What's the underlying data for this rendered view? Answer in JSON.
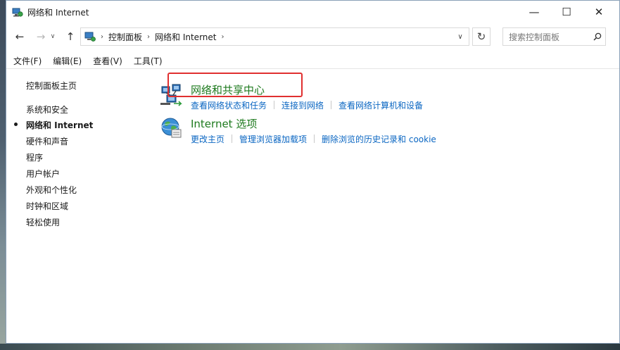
{
  "window": {
    "title": "网络和 Internet",
    "minimize_glyph": "—",
    "maximize_glyph": "☐",
    "close_glyph": "✕"
  },
  "navigation": {
    "back_glyph": "←",
    "forward_glyph": "→",
    "recent_glyph": "∨",
    "up_glyph": "↑",
    "breadcrumbs": [
      "控制面板",
      "网络和 Internet"
    ],
    "crumb_separator": "›",
    "dropdown_glyph": "∨",
    "refresh_glyph": "↻",
    "search_placeholder": "搜索控制面板"
  },
  "menu": {
    "items": [
      "文件(F)",
      "编辑(E)",
      "查看(V)",
      "工具(T)"
    ]
  },
  "sidebar": {
    "home": "控制面板主页",
    "items": [
      "系统和安全",
      "网络和 Internet",
      "硬件和声音",
      "程序",
      "用户帐户",
      "外观和个性化",
      "时钟和区域",
      "轻松使用"
    ],
    "current_index": 1
  },
  "categories": [
    {
      "title": "网络和共享中心",
      "icon": "network-sharing-icon",
      "links": [
        "查看网络状态和任务",
        "连接到网络",
        "查看网络计算机和设备"
      ]
    },
    {
      "title": "Internet 选项",
      "icon": "internet-globe-icon",
      "links": [
        "更改主页",
        "管理浏览器加载项",
        "删除浏览的历史记录和 cookie"
      ]
    }
  ],
  "colors": {
    "category_title": "#1e7a1e",
    "link": "#0a66c2",
    "highlight_border": "#e03030"
  }
}
